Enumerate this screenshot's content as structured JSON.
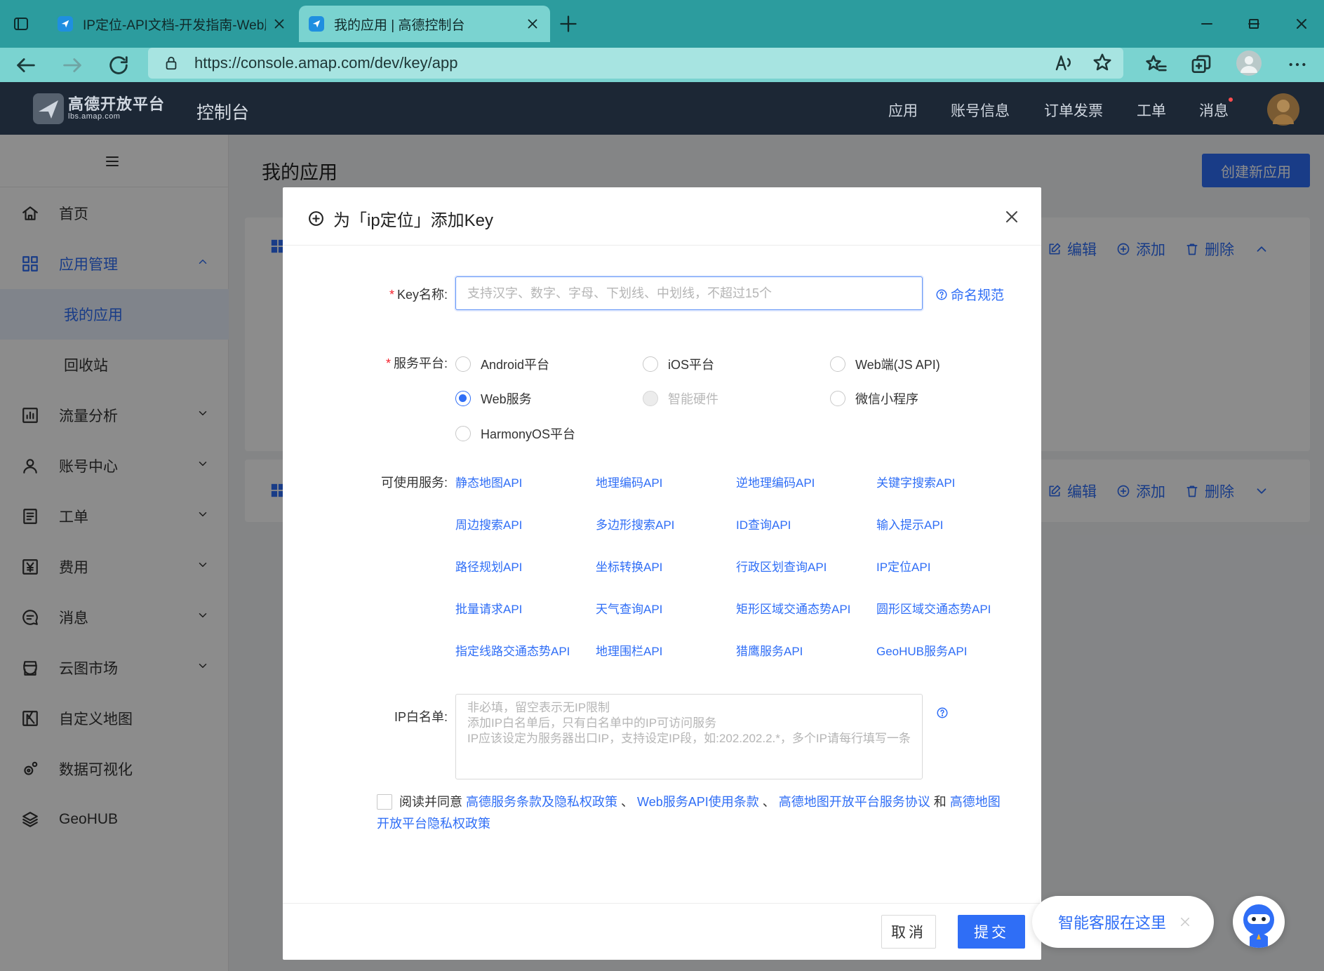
{
  "browser": {
    "tabs": [
      {
        "title": "IP定位-API文档-开发指南-Web服务",
        "active": false
      },
      {
        "title": "我的应用 | 高德控制台",
        "active": true
      }
    ],
    "url": "https://console.amap.com/dev/key/app"
  },
  "header": {
    "logo_text": "高德开放平台",
    "logo_sub": "lbs.amap.com",
    "console_label": "控制台",
    "nav": [
      "应用",
      "账号信息",
      "订单发票",
      "工单",
      "消息"
    ]
  },
  "sidebar": {
    "items": [
      {
        "label": "首页",
        "icon": "home-icon"
      },
      {
        "label": "应用管理",
        "icon": "apps-grid-icon",
        "expanded": true
      },
      {
        "label": "我的应用",
        "sub": true,
        "selected": true
      },
      {
        "label": "回收站",
        "sub": true
      },
      {
        "label": "流量分析",
        "icon": "bar-chart-icon"
      },
      {
        "label": "账号中心",
        "icon": "user-icon"
      },
      {
        "label": "工单",
        "icon": "ticket-icon"
      },
      {
        "label": "费用",
        "icon": "yuan-icon"
      },
      {
        "label": "消息",
        "icon": "message-icon"
      },
      {
        "label": "云图市场",
        "icon": "store-icon"
      },
      {
        "label": "自定义地图",
        "icon": "custom-map-icon"
      },
      {
        "label": "数据可视化",
        "icon": "visualization-icon"
      },
      {
        "label": "GeoHUB",
        "icon": "layers-icon"
      }
    ]
  },
  "main": {
    "title": "我的应用",
    "create_button": "创建新应用",
    "card_actions": {
      "edit": "编辑",
      "add": "添加",
      "delete": "删除"
    }
  },
  "modal": {
    "title": "为「ip定位」添加Key",
    "key_name_label": "Key名称:",
    "key_name_placeholder": "支持汉字、数字、字母、下划线、中划线，不超过15个",
    "naming_rule_link": "命名规范",
    "platform_label": "服务平台:",
    "platforms": [
      {
        "label": "Android平台",
        "checked": false,
        "disabled": false
      },
      {
        "label": "iOS平台",
        "checked": false,
        "disabled": false
      },
      {
        "label": "Web端(JS API)",
        "checked": false,
        "disabled": false
      },
      {
        "label": "Web服务",
        "checked": true,
        "disabled": false
      },
      {
        "label": "智能硬件",
        "checked": false,
        "disabled": true
      },
      {
        "label": "微信小程序",
        "checked": false,
        "disabled": false
      },
      {
        "label": "HarmonyOS平台",
        "checked": false,
        "disabled": false
      }
    ],
    "services_label": "可使用服务:",
    "services": [
      "静态地图API",
      "地理编码API",
      "逆地理编码API",
      "关键字搜索API",
      "周边搜索API",
      "多边形搜索API",
      "ID查询API",
      "输入提示API",
      "路径规划API",
      "坐标转换API",
      "行政区划查询API",
      "IP定位API",
      "批量请求API",
      "天气查询API",
      "矩形区域交通态势API",
      "圆形区域交通态势API",
      "指定线路交通态势API",
      "地理围栏API",
      "猎鹰服务API",
      "GeoHUB服务API"
    ],
    "ip_label": "IP白名单:",
    "ip_placeholder": "非必填，留空表示无IP限制\n添加IP白名单后，只有白名单中的IP可访问服务\nIP应该设定为服务器出口IP，支持设定IP段，如:202.202.2.*，多个IP请每行填写一条",
    "agree": {
      "prefix": "阅读并同意",
      "link1": "高德服务条款及隐私权政策",
      "sep1": "、",
      "link2": "Web服务API使用条款",
      "sep2": "、",
      "link3": "高德地图开放平台服务协议",
      "and": "和",
      "link4": "高德地图开放平台隐私权政策"
    },
    "cancel": "取消",
    "submit": "提交"
  },
  "chat": {
    "label": "智能客服在这里"
  },
  "colors": {
    "accent": "#2f6ef6",
    "header_bg": "#1c2735",
    "browser_tab": "#2c9c9e",
    "browser_toolbar": "#7ad3d0",
    "required": "#f5222d"
  }
}
